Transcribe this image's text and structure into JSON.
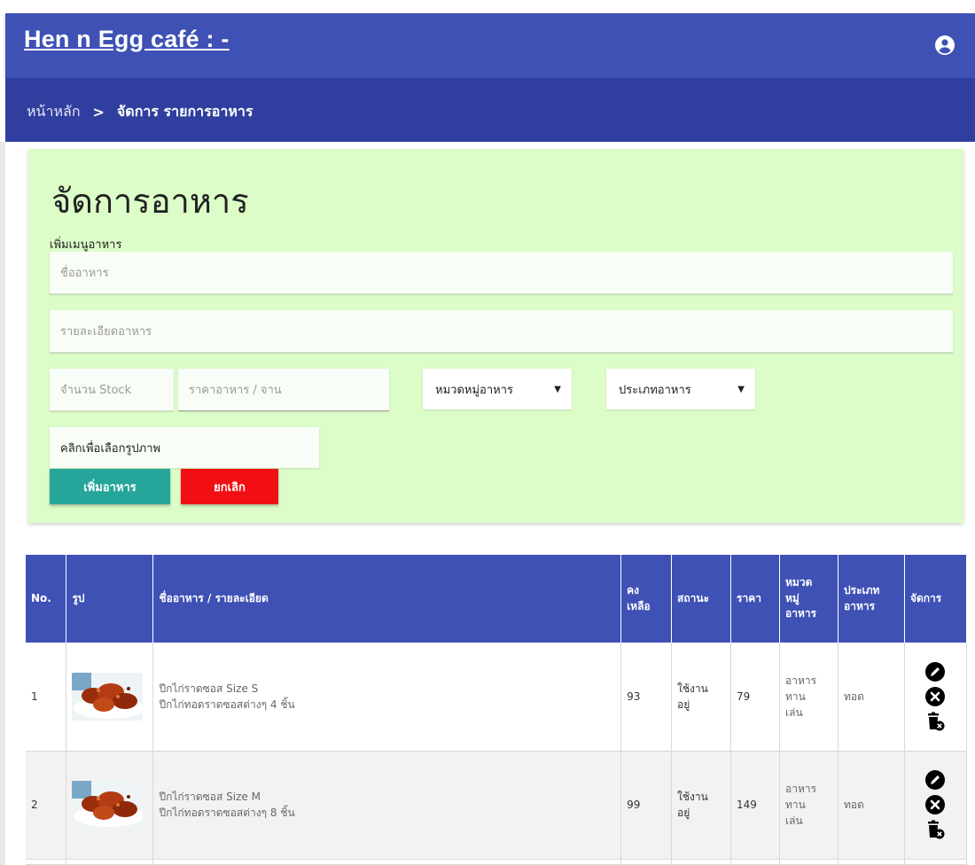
{
  "app": {
    "title": "Hen n Egg café : -",
    "account_icon": "account-circle-icon"
  },
  "breadcrumb": {
    "home": "หน้าหลัก",
    "separator": ">",
    "current": "จัดการ รายการอาหาร"
  },
  "form": {
    "title": "จัดการอาหาร",
    "add_label": "เพิ่มเมนูอาหาร",
    "name_placeholder": "ชื่ออาหาร",
    "desc_placeholder": "รายละเอียดอาหาร",
    "stock_placeholder": "จำนวน Stock",
    "price_placeholder": "ราคาอาหาร / จาน",
    "category_select": "หมวดหมู่อาหาร",
    "type_select": "ประเภทอาหาร",
    "image_button": "คลิกเพื่อเลือกรูปภาพ",
    "add_button": "เพิ่มอาหาร",
    "cancel_button": "ยกเลิก"
  },
  "table": {
    "headers": {
      "no": "No.",
      "image": "รูป",
      "name": "ชื่ออาหาร / รายละเอียด",
      "stock_1": "คง",
      "stock_2": "เหลือ",
      "status": "สถานะ",
      "price": "ราคา",
      "category_1": "หมวด",
      "category_2": "หมู่",
      "category_3": "อาหาร",
      "type_1": "ประเภท",
      "type_2": "อาหาร",
      "actions": "จัดการ"
    },
    "rows": [
      {
        "no": "1",
        "name": "ปีกไก่ราดซอส Size S",
        "detail": "ปีกไก่ทอดราดซอสต่างๆ 4 ชิ้น",
        "stock": "93",
        "status_1": "ใช้งาน",
        "status_2": "อยู่",
        "price": "79",
        "category_1": "อาหาร",
        "category_2": "ทาน",
        "category_3": "เล่น",
        "type": "ทอด"
      },
      {
        "no": "2",
        "name": "ปีกไก่ราดซอส Size M",
        "detail": "ปีกไก่ทอดราดซอสต่างๆ 8 ชิ้น",
        "stock": "99",
        "status_1": "ใช้งาน",
        "status_2": "อยู่",
        "price": "149",
        "category_1": "อาหาร",
        "category_2": "ทาน",
        "category_3": "เล่น",
        "type": "ทอด"
      }
    ],
    "action_icons": [
      "edit-icon",
      "cancel-icon",
      "delete-icon"
    ]
  },
  "colors": {
    "primary": "#3f51b5",
    "primary_dark": "#303f9f",
    "card_bg": "#dcfcc8",
    "teal": "#26a69a",
    "red": "#f20f13"
  }
}
